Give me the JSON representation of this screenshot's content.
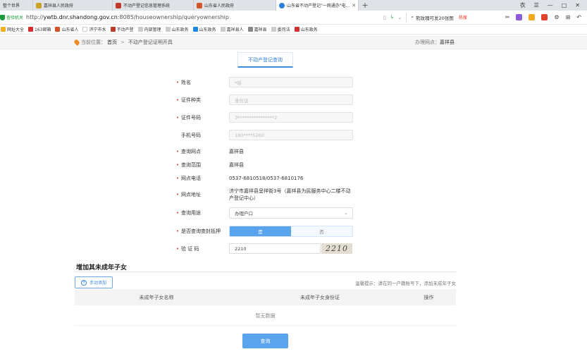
{
  "browser": {
    "tabs": [
      {
        "label": "整个世界",
        "color": "#dfe3e8",
        "active": false
      },
      {
        "label": "嘉祥县人民政府",
        "color": "#c9a227",
        "active": false
      },
      {
        "label": "不动产登记信息管理系统",
        "color": "#c0392b",
        "active": false
      },
      {
        "label": "山东省人民政府",
        "color": "#d4542a",
        "active": false
      },
      {
        "label": "山东省不动产登记\"一网通办\"电...",
        "color": "#2f7ed8",
        "active": true
      }
    ],
    "new_tab": "+",
    "window_controls": [
      "衣",
      "☰",
      "—",
      "□",
      "✕"
    ],
    "secure_label": "查验机关",
    "url_prefix": "http://",
    "url_host": "ywtb.dnr.shandong.gov.cn",
    "url_rest": ":8085/houseownership/queryownership",
    "search_text": "熊玫瑰可发20张图",
    "search_hot": "热搜",
    "bookmarks": [
      {
        "label": "网址大全",
        "color": "#f2b01e"
      },
      {
        "label": "163邮箱",
        "color": "#d32f2f"
      },
      {
        "label": "山东省人",
        "color": "#d4542a"
      },
      {
        "label": "济宁市水",
        "color": "#ffffff"
      },
      {
        "label": "不动产登",
        "color": "#c0392b"
      },
      {
        "label": "内部管理",
        "color": "#cccccc"
      },
      {
        "label": "山东政务",
        "color": "#cccccc"
      },
      {
        "label": "山东政务",
        "color": "#1e88e5"
      },
      {
        "label": "嘉祥县人",
        "color": "#cccccc"
      },
      {
        "label": "嘉祥县",
        "color": "#888888"
      },
      {
        "label": "委司法",
        "color": "#cccccc"
      },
      {
        "label": "山东政务",
        "color": "#d32f2f"
      }
    ]
  },
  "breadcrumb": {
    "prefix": "当前位置：",
    "home": "首页",
    "sep": ">",
    "current": "不动产登记证明开具",
    "office_label": "办理网点：",
    "office_value": "嘉祥县"
  },
  "top_tab": "不动产登记查询",
  "form": {
    "name": {
      "label": "姓名",
      "placeholder": "*瑶"
    },
    "id_type": {
      "label": "证件种类",
      "placeholder": "身份证"
    },
    "id_number": {
      "label": "证件号码",
      "placeholder": "3****************2"
    },
    "phone": {
      "label": "手机号码",
      "placeholder": "180****5260"
    },
    "query_office": {
      "label": "查询网点",
      "value": "嘉祥县"
    },
    "query_scope": {
      "label": "查询范围",
      "value": "嘉祥县"
    },
    "office_phone": {
      "label": "网点电话",
      "value": "0537-6810518/0537-6810176"
    },
    "office_address": {
      "label": "网点地址",
      "value": "济宁市嘉祥县呈祥街3号（嘉祥县为民服务中心二楼不动产登记中心）"
    },
    "purpose": {
      "label": "查询用途",
      "value": "办理户口"
    },
    "seal_query": {
      "label": "是否查询查封抵押",
      "yes": "是",
      "no": "否",
      "selected": "是"
    },
    "captcha": {
      "label": "验 证 码",
      "value": "2210",
      "image_text": "2210"
    }
  },
  "minor_section": {
    "title": "增加其未成年子女",
    "add_button": "手动添加",
    "tip": "温馨提示：请在同一户籍账号下，添加未成年子女",
    "columns": [
      "未成年子女名称",
      "未成年子女身份证",
      "操作"
    ],
    "empty": "暂无数据"
  },
  "submit_label": "查询"
}
